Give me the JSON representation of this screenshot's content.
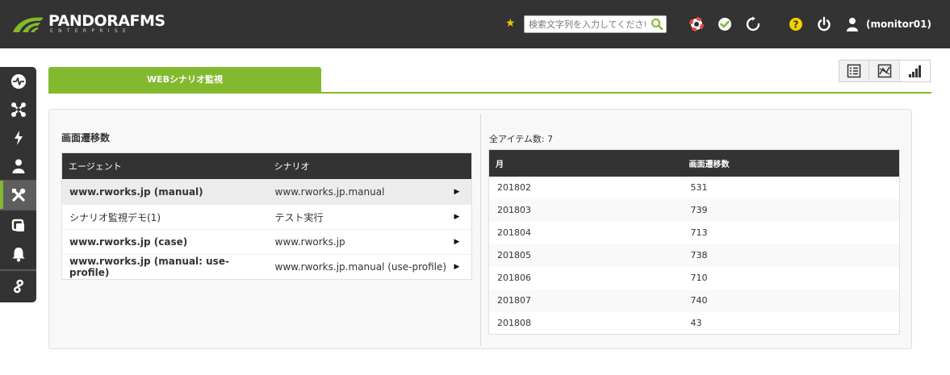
{
  "header": {
    "logo_name": "PANDORAFMS",
    "logo_sub": "ENTERPRISE",
    "search_placeholder": "検索文字列を入力してください",
    "user": "(monitor01)",
    "accent_color": "#82b92e"
  },
  "sidebar": {
    "items": [
      {
        "icon": "monitoring-icon",
        "active": false
      },
      {
        "icon": "network-topology-icon",
        "active": false
      },
      {
        "icon": "events-lightning-icon",
        "active": false
      },
      {
        "icon": "user-icon",
        "active": false
      },
      {
        "icon": "tools-icon",
        "active": true
      },
      {
        "icon": "devices-icon",
        "active": false
      },
      {
        "icon": "alerts-bell-icon",
        "active": false
      },
      {
        "icon": "links-icon",
        "active": false
      }
    ]
  },
  "tabs": {
    "active_label": "WEBシナリオ監視"
  },
  "left_panel": {
    "title": "画面遷移数",
    "columns": [
      "エージェント",
      "シナリオ"
    ],
    "rows": [
      {
        "agent": "www.rworks.jp (manual)",
        "scenario": "www.rworks.jp.manual",
        "arrow": "▶"
      },
      {
        "agent": "シナリオ監視デモ(1)",
        "scenario": "テスト実行",
        "arrow": "▶"
      },
      {
        "agent": "www.rworks.jp (case)",
        "scenario": "www.rworks.jp",
        "arrow": "▶"
      },
      {
        "agent": "www.rworks.jp (manual: use-profile)",
        "scenario": "www.rworks.jp.manual (use-profile)",
        "arrow": "▶"
      }
    ]
  },
  "right_panel": {
    "count_label": "全アイテム数: 7",
    "columns": [
      "月",
      "画面遷移数"
    ],
    "rows": [
      {
        "month": "201802",
        "value": "531"
      },
      {
        "month": "201803",
        "value": "739"
      },
      {
        "month": "201804",
        "value": "713"
      },
      {
        "month": "201805",
        "value": "738"
      },
      {
        "month": "201806",
        "value": "710"
      },
      {
        "month": "201807",
        "value": "740"
      },
      {
        "month": "201808",
        "value": "43"
      }
    ]
  }
}
